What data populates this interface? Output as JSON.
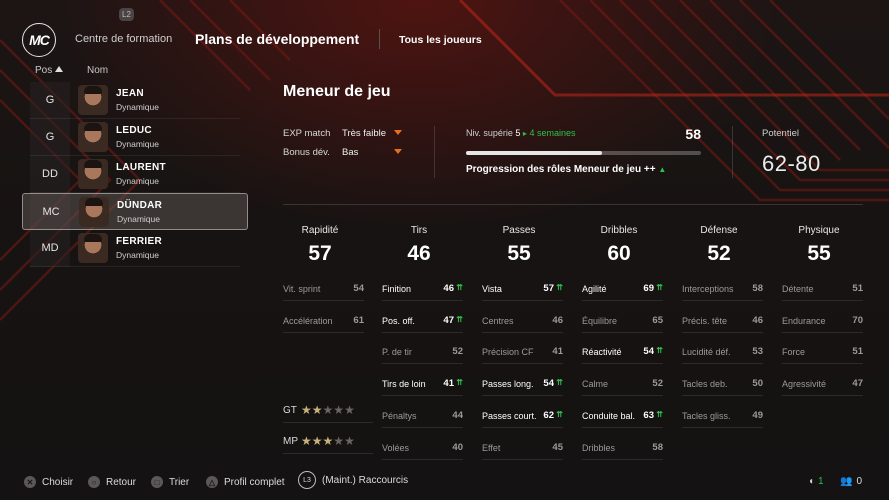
{
  "header": {
    "logo": "MC",
    "l1_badge": "L2",
    "tabs": [
      "Centre de formation",
      "Plans de développement",
      "Tous les joueurs"
    ],
    "active_tab": 1
  },
  "list": {
    "col_pos": "Pos",
    "col_name": "Nom",
    "players": [
      {
        "pos": "G",
        "name": "JEAN",
        "type": "Dynamique"
      },
      {
        "pos": "G",
        "name": "LEDUC",
        "type": "Dynamique"
      },
      {
        "pos": "DD",
        "name": "LAURENT",
        "type": "Dynamique"
      },
      {
        "pos": "MC",
        "name": "DÜNDAR",
        "type": "Dynamique",
        "selected": true
      },
      {
        "pos": "MD",
        "name": "FERRIER",
        "type": "Dynamique"
      }
    ]
  },
  "role": {
    "title": "Meneur de jeu",
    "exp_label": "EXP match",
    "exp_value": "Très faible",
    "bonus_label": "Bonus dév.",
    "bonus_value": "Bas",
    "niv_label": "Niv. supérie",
    "niv_value": "5",
    "niv_arrow": "▸",
    "niv_weeks": "4 semaines",
    "niv_number": "58",
    "progress_fraction": 0.58,
    "prog_label": "Progression des rôles",
    "prog_role": "Meneur de jeu",
    "prog_plus": "++",
    "prog_up": "▲",
    "potential_label": "Potentiel",
    "potential_value": "62-80"
  },
  "attributes": [
    {
      "name": "Rapidité",
      "value": "57",
      "stats": [
        {
          "label": "Vit. sprint",
          "value": "54",
          "hi": false
        },
        {
          "label": "Accélération",
          "value": "61",
          "hi": false
        }
      ]
    },
    {
      "name": "Tirs",
      "value": "46",
      "stats": [
        {
          "label": "Finition",
          "value": "46",
          "hi": true
        },
        {
          "label": "Pos. off.",
          "value": "47",
          "hi": true
        },
        {
          "label": "P. de tir",
          "value": "52",
          "hi": false
        },
        {
          "label": "Tirs de loin",
          "value": "41",
          "hi": true
        },
        {
          "label": "Pénaltys",
          "value": "44",
          "hi": false
        },
        {
          "label": "Volées",
          "value": "40",
          "hi": false
        }
      ]
    },
    {
      "name": "Passes",
      "value": "55",
      "stats": [
        {
          "label": "Vista",
          "value": "57",
          "hi": true
        },
        {
          "label": "Centres",
          "value": "46",
          "hi": false
        },
        {
          "label": "Précision CF",
          "value": "41",
          "hi": false
        },
        {
          "label": "Passes long.",
          "value": "54",
          "hi": true
        },
        {
          "label": "Passes court.",
          "value": "62",
          "hi": true
        },
        {
          "label": "Effet",
          "value": "45",
          "hi": false
        }
      ]
    },
    {
      "name": "Dribbles",
      "value": "60",
      "stats": [
        {
          "label": "Agilité",
          "value": "69",
          "hi": true
        },
        {
          "label": "Équilibre",
          "value": "65",
          "hi": false
        },
        {
          "label": "Réactivité",
          "value": "54",
          "hi": true
        },
        {
          "label": "Calme",
          "value": "52",
          "hi": false
        },
        {
          "label": "Conduite bal.",
          "value": "63",
          "hi": true
        },
        {
          "label": "Dribbles",
          "value": "58",
          "hi": false
        }
      ]
    },
    {
      "name": "Défense",
      "value": "52",
      "stats": [
        {
          "label": "Interceptions",
          "value": "58",
          "hi": false
        },
        {
          "label": "Précis. tête",
          "value": "46",
          "hi": false
        },
        {
          "label": "Lucidité déf.",
          "value": "53",
          "hi": false
        },
        {
          "label": "Tacles deb.",
          "value": "50",
          "hi": false
        },
        {
          "label": "Tacles gliss.",
          "value": "49",
          "hi": false
        }
      ]
    },
    {
      "name": "Physique",
      "value": "55",
      "stats": [
        {
          "label": "Détente",
          "value": "51",
          "hi": false
        },
        {
          "label": "Endurance",
          "value": "70",
          "hi": false
        },
        {
          "label": "Force",
          "value": "51",
          "hi": false
        },
        {
          "label": "Agressivité",
          "value": "47",
          "hi": false
        }
      ]
    }
  ],
  "skill_ratings": [
    {
      "label": "GT",
      "stars": 2,
      "max": 5
    },
    {
      "label": "MP",
      "stars": 3,
      "max": 5
    }
  ],
  "up_arrow_glyph": "⇈",
  "footer": {
    "buttons": [
      {
        "icon": "cross-button-icon",
        "glyph": "✕",
        "label": "Choisir"
      },
      {
        "icon": "circle-button-icon",
        "glyph": "○",
        "label": "Retour"
      },
      {
        "icon": "square-button-icon",
        "glyph": "□",
        "label": "Trier"
      },
      {
        "icon": "triangle-button-icon",
        "glyph": "△",
        "label": "Profil complet"
      }
    ],
    "l3_glyph": "L3",
    "shortcuts_label": "(Maint.) Raccourcis",
    "counter_1": "1",
    "counter_2": "0"
  },
  "colors": {
    "accent_red": "#b0281c",
    "progress_green": "#2fbf4c",
    "caret_orange": "#e8701c",
    "star_gold": "#c9b27a"
  }
}
